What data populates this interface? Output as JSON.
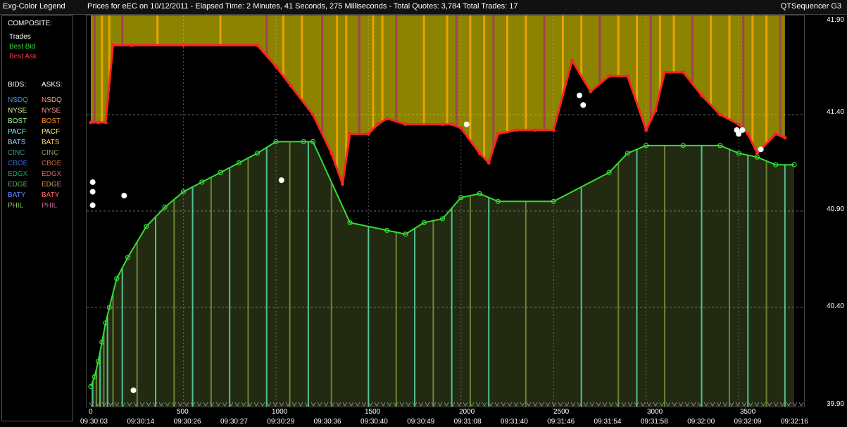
{
  "header": {
    "legend_title": "Exg-Color Legend",
    "title": "Prices for  eEC  on  10/12/2011  -  Elapsed Time: 2 Minutes, 41 Seconds, 275 Milliseconds  -  Total Quotes: 3,784  Total Trades: 17",
    "app_name": "QTSequencer G3"
  },
  "legend": {
    "composite_label": "COMPOSITE:",
    "composite": [
      {
        "label": "Trades",
        "color": "#ffffff"
      },
      {
        "label": "Best Bid",
        "color": "#33dd33"
      },
      {
        "label": "Best Ask",
        "color": "#ff3333"
      }
    ],
    "bids_label": "BIDS:",
    "asks_label": "ASKS:",
    "exchanges": [
      {
        "bid": "NSDQ",
        "ask": "NSDQ",
        "bid_color": "#3399ff",
        "ask_color": "#ff9966"
      },
      {
        "bid": "NYSE",
        "ask": "NYSE",
        "bid_color": "#ccff99",
        "ask_color": "#ff9999"
      },
      {
        "bid": "BOST",
        "ask": "BOST",
        "bid_color": "#99ff99",
        "ask_color": "#ff9933"
      },
      {
        "bid": "PACF",
        "ask": "PACF",
        "bid_color": "#66ffff",
        "ask_color": "#ffff66"
      },
      {
        "bid": "BATS",
        "ask": "BATS",
        "bid_color": "#99ccff",
        "ask_color": "#ffcc66"
      },
      {
        "bid": "CINC",
        "ask": "CINC",
        "bid_color": "#339999",
        "ask_color": "#999966"
      },
      {
        "bid": "CBOE",
        "ask": "CBOE",
        "bid_color": "#3366cc",
        "ask_color": "#cc6633"
      },
      {
        "bid": "EDGX",
        "ask": "EDGX",
        "bid_color": "#339966",
        "ask_color": "#cc6666"
      },
      {
        "bid": "EDGE",
        "ask": "EDGE",
        "bid_color": "#66aa66",
        "ask_color": "#cc9966"
      },
      {
        "bid": "BATY",
        "ask": "BATY",
        "bid_color": "#6688ff",
        "ask_color": "#ff6666"
      },
      {
        "bid": "PHIL",
        "ask": "PHIL",
        "bid_color": "#99cc66",
        "ask_color": "#cc6699"
      }
    ]
  },
  "colors": {
    "trade": "#ffffff",
    "best_bid": "#33dd33",
    "best_ask": "#ff2222",
    "ask_fill": "#ffee00",
    "ask_fill_2": "#ffaa00",
    "ask_fill_3": "#aa3366",
    "bid_fill": "#66ffcc",
    "bid_fill_2": "#88aa44"
  },
  "chart_data": {
    "type": "line",
    "x_ticks": [
      "0",
      "500",
      "1000",
      "1500",
      "2000",
      "2500",
      "3000",
      "3500"
    ],
    "time_ticks": [
      "09:30:03",
      "09:30:14",
      "09:30:26",
      "09:30:27",
      "09:30:29",
      "09:30:36",
      "09:30:40",
      "09:30:49",
      "09:31:08",
      "09:31:40",
      "09:31:46",
      "09:31:54",
      "09:31:58",
      "09:32:00",
      "09:32:09",
      "09:32:16"
    ],
    "y_ticks": [
      "41.90",
      "41.40",
      "40.90",
      "40.40",
      "39.90"
    ],
    "ylim": [
      39.9,
      41.9
    ],
    "xlim": [
      0,
      3800
    ],
    "best_ask": {
      "x": [
        0,
        40,
        80,
        120,
        220,
        500,
        900,
        1000,
        1080,
        1200,
        1300,
        1360,
        1400,
        1500,
        1550,
        1600,
        1700,
        1900,
        1950,
        2000,
        2100,
        2150,
        2200,
        2300,
        2400,
        2500,
        2600,
        2700,
        2800,
        2900,
        3000,
        3050,
        3100,
        3200,
        3300,
        3400,
        3500,
        3550,
        3600,
        3700,
        3750
      ],
      "y": [
        41.36,
        41.36,
        41.36,
        41.76,
        41.76,
        41.76,
        41.76,
        41.65,
        41.55,
        41.4,
        41.2,
        41.04,
        41.3,
        41.3,
        41.35,
        41.38,
        41.35,
        41.35,
        41.35,
        41.33,
        41.2,
        41.15,
        41.3,
        41.32,
        41.32,
        41.32,
        41.68,
        41.52,
        41.6,
        41.6,
        41.32,
        41.42,
        41.62,
        41.62,
        41.5,
        41.4,
        41.35,
        41.3,
        41.2,
        41.3,
        41.28
      ]
    },
    "best_bid": {
      "x": [
        0,
        20,
        40,
        60,
        80,
        100,
        140,
        200,
        300,
        400,
        500,
        600,
        700,
        800,
        900,
        1000,
        1150,
        1200,
        1400,
        1600,
        1700,
        1800,
        1900,
        2000,
        2100,
        2200,
        2500,
        2800,
        2900,
        3000,
        3200,
        3400,
        3500,
        3600,
        3700,
        3800
      ],
      "y": [
        39.99,
        40.04,
        40.12,
        40.22,
        40.32,
        40.4,
        40.55,
        40.66,
        40.82,
        40.92,
        41.0,
        41.05,
        41.1,
        41.15,
        41.2,
        41.26,
        41.26,
        41.26,
        40.84,
        40.8,
        40.78,
        40.84,
        40.86,
        40.97,
        40.99,
        40.95,
        40.95,
        41.1,
        41.2,
        41.24,
        41.24,
        41.24,
        41.2,
        41.18,
        41.14,
        41.14
      ]
    },
    "trades": {
      "x": [
        10,
        10,
        10,
        180,
        230,
        1030,
        2030,
        2640,
        2660,
        3490,
        3500,
        3520,
        3620
      ],
      "y": [
        41.05,
        41.0,
        40.93,
        40.98,
        39.97,
        41.06,
        41.35,
        41.5,
        41.45,
        41.32,
        41.3,
        41.32,
        41.22
      ]
    }
  }
}
